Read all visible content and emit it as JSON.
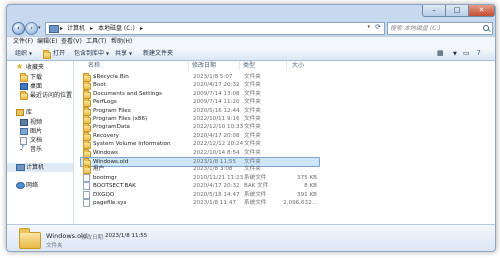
{
  "address": {
    "crumbs": [
      "计算机",
      "本地磁盘 (C:)"
    ],
    "search_placeholder": "搜索 本地磁盘 (C:)"
  },
  "menu": [
    "文件(F)",
    "编辑(E)",
    "查看(V)",
    "工具(T)",
    "帮助(H)"
  ],
  "toolbar": {
    "organize": "组织",
    "open": "打开",
    "include": "包含到库中",
    "share": "共享",
    "new_folder": "新建文件夹"
  },
  "sidebar": {
    "favorites": "收藏夹",
    "downloads": "下载",
    "desktop": "桌面",
    "recent": "最近访问的位置",
    "libraries": "库",
    "videos": "视频",
    "pictures": "图片",
    "documents": "文档",
    "music": "音乐",
    "computer": "计算机",
    "network": "网络"
  },
  "columns": {
    "name": "名称",
    "date": "修改日期",
    "type": "类型",
    "size": "大小"
  },
  "files": [
    {
      "name": "$Recycle.Bin",
      "date": "2023/1/8 5:07",
      "type": "文件夹",
      "size": "",
      "icon": "folder"
    },
    {
      "name": "Boot",
      "date": "2020/4/17 20:32",
      "type": "文件夹",
      "size": "",
      "icon": "folder"
    },
    {
      "name": "Documents and Settings",
      "date": "2009/7/14 13:08",
      "type": "文件夹",
      "size": "",
      "icon": "folder"
    },
    {
      "name": "PerfLogs",
      "date": "2009/7/14 11:20",
      "type": "文件夹",
      "size": "",
      "icon": "folder"
    },
    {
      "name": "Program Files",
      "date": "2020/5/16 12:44",
      "type": "文件夹",
      "size": "",
      "icon": "folder"
    },
    {
      "name": "Program Files (x86)",
      "date": "2022/10/11 9:16",
      "type": "文件夹",
      "size": "",
      "icon": "folder"
    },
    {
      "name": "ProgramData",
      "date": "2022/12/10 10:33",
      "type": "文件夹",
      "size": "",
      "icon": "folder"
    },
    {
      "name": "Recovery",
      "date": "2020/4/17 20:08",
      "type": "文件夹",
      "size": "",
      "icon": "folder"
    },
    {
      "name": "System Volume Information",
      "date": "2022/12/12 20:24",
      "type": "文件夹",
      "size": "",
      "icon": "folder"
    },
    {
      "name": "Windows",
      "date": "2022/10/14 8:54",
      "type": "文件夹",
      "size": "",
      "icon": "folder"
    },
    {
      "name": "Windows.old",
      "date": "2023/1/8 11:55",
      "type": "文件夹",
      "size": "",
      "icon": "folder",
      "selected": true
    },
    {
      "name": "用户",
      "date": "2023/1/8 3:08",
      "type": "文件夹",
      "size": "",
      "icon": "folder"
    },
    {
      "name": "bootmgr",
      "date": "2010/11/21 11:23",
      "type": "系统文件",
      "size": "375 KB",
      "icon": "file"
    },
    {
      "name": "BOOTSECT.BAK",
      "date": "2020/4/17 20:32",
      "type": "BAK 文件",
      "size": "8 KB",
      "icon": "file"
    },
    {
      "name": "DXGQO",
      "date": "2020/5/18 14:47",
      "type": "系统文件",
      "size": "391 KB",
      "icon": "file"
    },
    {
      "name": "pagefile.sys",
      "date": "2023/1/8 11:47",
      "type": "系统文件",
      "size": "2,096,632...",
      "icon": "file"
    }
  ],
  "details": {
    "name": "Windows.old",
    "modified_label": "修改日期:",
    "modified_value": "2023/1/8 11:55",
    "type": "文件夹"
  }
}
